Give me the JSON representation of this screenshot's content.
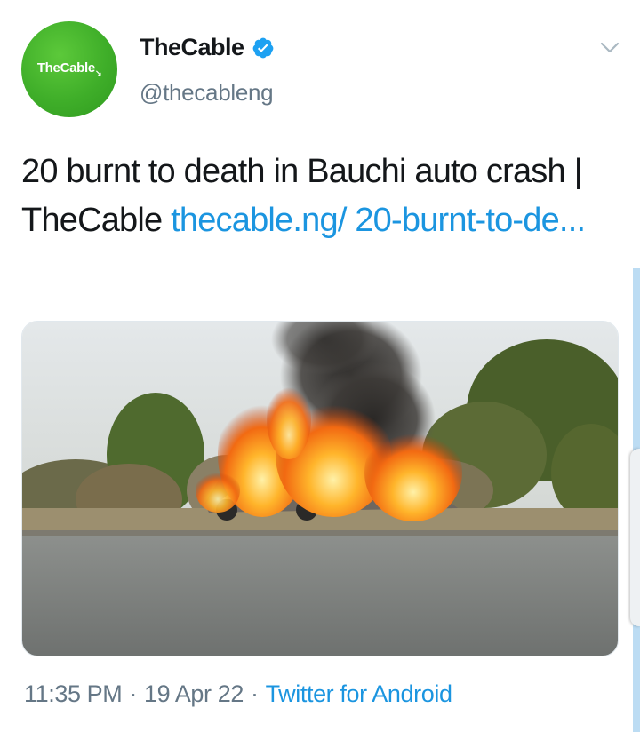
{
  "account": {
    "display_name": "TheCable",
    "handle": "@thecableng",
    "avatar_text": "TheCable",
    "verified": true,
    "brand_color": "#3fae29"
  },
  "tweet": {
    "text": "20 burnt to death in Bauchi auto crash | TheCable ",
    "link_text": "thecable.ng/ 20-burnt-to-de...",
    "link_color": "#1b95e0"
  },
  "media": {
    "description_icon": "photo-burning-car"
  },
  "footer": {
    "time": "11:35 PM",
    "separator": "·",
    "date": "19 Apr 22",
    "source": "Twitter for Android"
  },
  "icons": {
    "more": "chevron-down-icon",
    "verified": "verified-badge-icon"
  }
}
